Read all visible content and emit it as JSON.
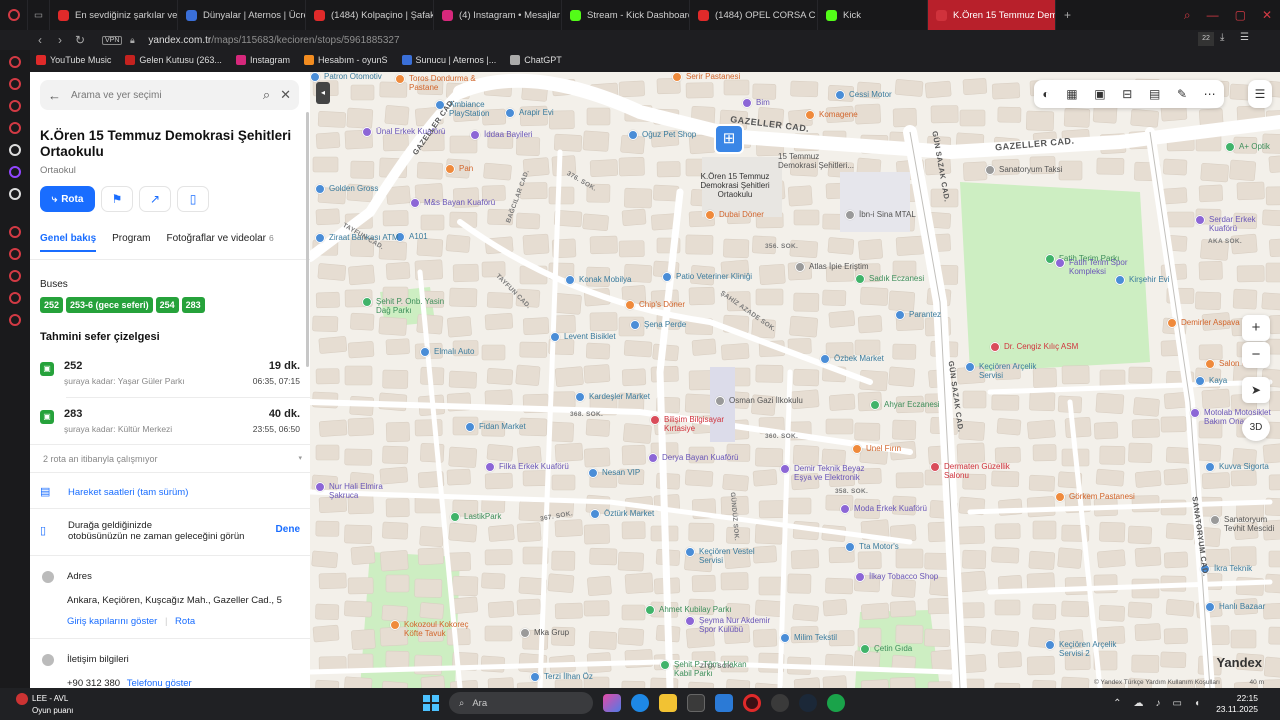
{
  "browser": {
    "tabs": [
      {
        "label": "En sevdiğiniz şarkılar ve a",
        "color": "#e02a2a"
      },
      {
        "label": "Dünyalar | Aternos | Ücre",
        "color": "#3a6fd8"
      },
      {
        "label": "(1484) Kolpaçino | Şafak",
        "color": "#e02a2a"
      },
      {
        "label": "(4) Instagram • Mesajlar",
        "color": "#d6287c"
      },
      {
        "label": "Stream - Kick Dashboard",
        "color": "#53fc18"
      },
      {
        "label": "(1484) OPEL CORSA C AK",
        "color": "#e02a2a"
      },
      {
        "label": "Kick",
        "color": "#53fc18"
      },
      {
        "label": "K.Ören 15 Temmuz Demok",
        "color": "#d0323c",
        "active": true
      }
    ],
    "new_tab": "+",
    "vpn": "VPN",
    "url_host": "yandex.com.tr",
    "url_path": "/maps/115683/kecioren/stops/5961885327",
    "bookmarks": [
      {
        "label": "YouTube Music",
        "color": "#e02a2a"
      },
      {
        "label": "Gelen Kutusu (263...",
        "color": "#c5221f"
      },
      {
        "label": "Instagram",
        "color": "#d6287c"
      },
      {
        "label": "Hesabım - oyunS",
        "color": "#f28c20"
      },
      {
        "label": "Sunucu | Aternos |...",
        "color": "#3a6fd8"
      },
      {
        "label": "ChatGPT",
        "color": "#aaaaaa"
      }
    ]
  },
  "panel": {
    "search_placeholder": "Arama ve yer seçimi",
    "title": "K.Ören 15 Temmuz Demokrasi Şehitleri Ortaokulu",
    "subtitle": "Ortaokul",
    "rota_label": "Rota",
    "tabs": [
      {
        "label": "Genel bakış",
        "active": true
      },
      {
        "label": "Program"
      },
      {
        "label": "Fotoğraflar ve videolar",
        "count": "6"
      }
    ],
    "buses_label": "Buses",
    "bus_lines": [
      "252",
      "253-6 (gece seferi)",
      "254",
      "283"
    ],
    "schedule_title": "Tahmini sefer çizelgesi",
    "schedule": [
      {
        "number": "252",
        "dest": "şuraya kadar: Yaşar Güler Parkı",
        "mins": "19 dk.",
        "times": "06:35, 07:15"
      },
      {
        "number": "283",
        "dest": "şuraya kadar: Kültür Merkezi",
        "mins": "40 dk.",
        "times": "23:55, 06:50"
      }
    ],
    "inactive_note": "2 rota an itibanyla çalışmıyor",
    "full_schedule_link": "Hareket saatleri (tam sürüm)",
    "arrival_text_1": "Durağa geldiğinizde",
    "arrival_text_2": "otobüsünüzün ne zaman geleceğini görün",
    "try_label": "Dene",
    "address_label": "Adres",
    "address": "Ankara, Keçiören, Kuşcağız Mah., Gazeller Cad., 5",
    "entrances_link": "Giriş kapılarını göster",
    "route_link": "Rota",
    "contact_label": "İletişim bilgileri",
    "phone": "+90 312 380",
    "show_phone": "Telefonu göster"
  },
  "map": {
    "labels": {
      "gazeller": "GAZELLER CAD.",
      "gazeller2": "GAZELLER CAD.",
      "gazeller3": "GAZELLER CAD.",
      "gunsazak": "GÜN SAZAK CAD.",
      "gunsazak2": "GÜN SAZAK CAD.",
      "sanatoryum": "SANATORYUM CAD.",
      "tayfun": "TAYFUN CAD.",
      "tayfun2": "TAYFUN CAD.",
      "bagcilar": "BAĞCILAR CAD.",
      "sahiz": "ŞAHİZ AZADE SOK.",
      "ziya": "ZİYA SOK.",
      "aka": "AKA SOK.",
      "s376": "376. SOK.",
      "s367": "367. SOK.",
      "s368": "368. SOK.",
      "s356": "356. SOK.",
      "s360": "360. SOK.",
      "s358": "358. SOK.",
      "gunduz": "GÜNDÜZ SOK.",
      "stop_name": "K.Ören 15 Temmuz Demokrasi Şehitleri Ortaokulu",
      "stop_name2": "15 Temmuz Demokrasi Şehitleri..."
    },
    "pois": [
      {
        "name": "Toros Dondurma & Pastane",
        "kind": "food"
      },
      {
        "name": "Serir Pastanesi",
        "kind": "food"
      },
      {
        "name": "Ambiance PlayStation",
        "kind": "poi"
      },
      {
        "name": "Arapir Evi",
        "kind": "poi"
      },
      {
        "name": "Bim",
        "kind": "shop"
      },
      {
        "name": "Cessi Motor",
        "kind": "poi"
      },
      {
        "name": "Komagene",
        "kind": "food"
      },
      {
        "name": "Ünal Erkek Kuaförü",
        "kind": "shop"
      },
      {
        "name": "İddaa Bayileri",
        "kind": "shop"
      },
      {
        "name": "Oğuz Pet Shop",
        "kind": "poi"
      },
      {
        "name": "Pan",
        "kind": "food"
      },
      {
        "name": "Golden Gross",
        "kind": "poi"
      },
      {
        "name": "M&s Bayan Kuaförü",
        "kind": "shop"
      },
      {
        "name": "Dubai Döner",
        "kind": "food"
      },
      {
        "name": "İbn-i Sina MTAL",
        "kind": "edu"
      },
      {
        "name": "A101",
        "kind": "poi"
      },
      {
        "name": "Ziraat Bankası ATM",
        "kind": "poi"
      },
      {
        "name": "Atlas İpie Eriştim",
        "kind": "edu"
      },
      {
        "name": "Sadık Eczanesi",
        "kind": "health"
      },
      {
        "name": "Fatih Terim Parkı",
        "kind": "health"
      },
      {
        "name": "Fatih Terim Spor Kompleksi",
        "kind": "shop"
      },
      {
        "name": "Kirşehir Evi",
        "kind": "poi"
      },
      {
        "name": "Serdar Erkek Kuaförü",
        "kind": "shop"
      },
      {
        "name": "A+ Optik",
        "kind": "health"
      },
      {
        "name": "Sanatoryum Taksi",
        "kind": "edu"
      },
      {
        "name": "Konak Mobilya",
        "kind": "poi"
      },
      {
        "name": "Patio Veteriner Kliniği",
        "kind": "poi"
      },
      {
        "name": "Chip's Döner",
        "kind": "food"
      },
      {
        "name": "Şena Perde",
        "kind": "poi"
      },
      {
        "name": "Parantez",
        "kind": "poi"
      },
      {
        "name": "Dr. Cengiz Kılıç ASM",
        "kind": "red"
      },
      {
        "name": "Demirler Aspava",
        "kind": "food"
      },
      {
        "name": "Şehit P. Onb. Yasin Dağ Parkı",
        "kind": "health"
      },
      {
        "name": "Levent Bisiklet",
        "kind": "poi"
      },
      {
        "name": "Elmalı Auto",
        "kind": "poi"
      },
      {
        "name": "Özbek Market",
        "kind": "poi"
      },
      {
        "name": "Keçiören Arçelik Servisi",
        "kind": "poi"
      },
      {
        "name": "Salon Özvar",
        "kind": "food"
      },
      {
        "name": "Kaya",
        "kind": "poi"
      },
      {
        "name": "Kardeşler Market",
        "kind": "poi"
      },
      {
        "name": "Osman Gazi İlkokulu",
        "kind": "edu"
      },
      {
        "name": "Ahyar Eczanesi",
        "kind": "health"
      },
      {
        "name": "Motolab Motosiklet Bakım Onarım",
        "kind": "shop"
      },
      {
        "name": "Bilişim Bilgisayar Kırtasiye",
        "kind": "red"
      },
      {
        "name": "Fidan Market",
        "kind": "poi"
      },
      {
        "name": "Unel Fırın",
        "kind": "food"
      },
      {
        "name": "Kuvva Sigorta",
        "kind": "poi"
      },
      {
        "name": "Derya Bayan Kuaförü",
        "kind": "shop"
      },
      {
        "name": "Filka Erkek Kuaförü",
        "kind": "shop"
      },
      {
        "name": "Nesan VIP",
        "kind": "poi"
      },
      {
        "name": "Demir Teknik Beyaz Eşya ve Elektronik",
        "kind": "shop"
      },
      {
        "name": "Dermaten Güzellik Salonu",
        "kind": "red"
      },
      {
        "name": "Nur Hali Elmira Şakruca",
        "kind": "shop"
      },
      {
        "name": "Öztürk Market",
        "kind": "poi"
      },
      {
        "name": "Moda Erkek Kuaförü",
        "kind": "shop"
      },
      {
        "name": "Görkem Pastanesi",
        "kind": "food"
      },
      {
        "name": "Sanatoryum Tevhit Mescidi",
        "kind": "edu"
      },
      {
        "name": "LastikPark",
        "kind": "health"
      },
      {
        "name": "Tta Motor's",
        "kind": "poi"
      },
      {
        "name": "Keçiören Vestel Servisi",
        "kind": "poi"
      },
      {
        "name": "İlkay Tobacco Shop",
        "kind": "shop"
      },
      {
        "name": "İkra Teknik",
        "kind": "poi"
      },
      {
        "name": "Kokozoul Kokoreç Köfte Tavuk",
        "kind": "food"
      },
      {
        "name": "Ahmet Kubilay Parkı",
        "kind": "health"
      },
      {
        "name": "Şeyma Nur Akdemir Spor Kulübü",
        "kind": "shop"
      },
      {
        "name": "Hanlı Bazaar",
        "kind": "poi"
      },
      {
        "name": "Keçiören Arçelik Servisi 2",
        "kind": "poi"
      },
      {
        "name": "Mka Grup",
        "kind": "edu"
      },
      {
        "name": "Milim Tekstil",
        "kind": "poi"
      },
      {
        "name": "Çetin Gıda",
        "kind": "health"
      },
      {
        "name": "Şehit P. Tğm. Hakan Kabil Parkı",
        "kind": "health"
      },
      {
        "name": "Terzi İlhan Öz",
        "kind": "poi"
      },
      {
        "name": "Patron Otomotiv",
        "kind": "poi"
      }
    ],
    "toolbar_3d": "3D",
    "zoom_in": "+",
    "zoom_out": "−",
    "attribution": "© Yandex   Türkçe   Yardım   Kullanım Koşulları",
    "logo": "Yandex",
    "scale": "40 m"
  },
  "taskbar": {
    "weather_title": "LEE - AVL",
    "weather_sub": "Oyun puanı",
    "search": "Ara",
    "time": "22:15",
    "date": "23.11.2025"
  }
}
